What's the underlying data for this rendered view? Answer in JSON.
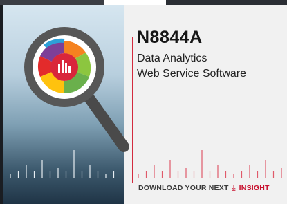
{
  "product": {
    "code": "N8844A",
    "description_line1": "Data Analytics",
    "description_line2": "Web Service Software"
  },
  "footer": {
    "prefix": "DOWNLOAD YOUR NEXT",
    "icon": "download-icon",
    "highlight": "INSIGHT"
  },
  "colors": {
    "brand_red": "#c8102e",
    "title_text": "#161616",
    "panel_bg": "#f1f1f1",
    "magnifier_ring": "#5a5a5a",
    "chart_slices": [
      "#e32b2b",
      "#f58220",
      "#ffc20e",
      "#8cc63f",
      "#2e9fd8",
      "#7d3f98"
    ]
  }
}
